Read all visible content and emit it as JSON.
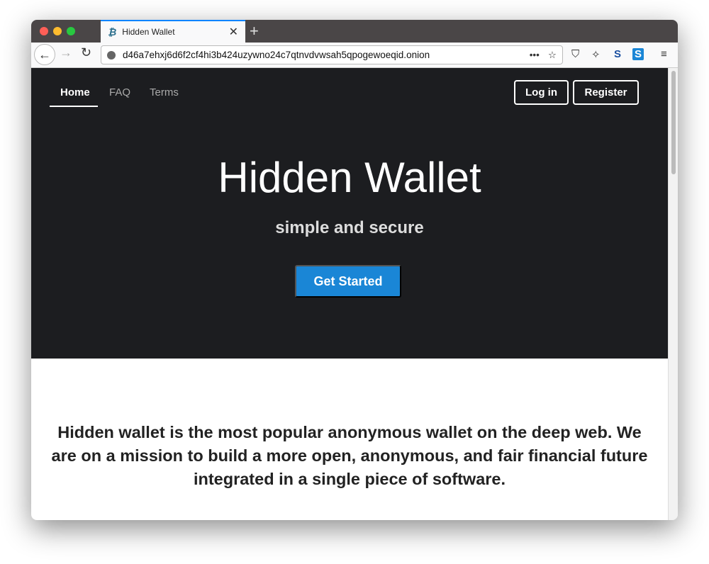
{
  "browser": {
    "tab_title": "Hidden Wallet",
    "tab_icon": "bitcoin-icon",
    "url": "d46a7ehxj6d6f2cf4hi3b424uzywno24c7qtnvdvwsah5qpogewoeqid.onion",
    "colors": {
      "close": "#fe5f57",
      "minimize": "#febc2e",
      "maximize": "#28c840",
      "tab_accent": "#0a84ff"
    }
  },
  "nav": {
    "items": [
      {
        "label": "Home",
        "active": true
      },
      {
        "label": "FAQ"
      },
      {
        "label": "Terms"
      }
    ],
    "login": "Log in",
    "register": "Register"
  },
  "hero": {
    "title": "Hidden Wallet",
    "subtitle": "simple and secure",
    "cta": "Get Started",
    "cta_color": "#1a86d6",
    "bg": "#1c1d20"
  },
  "mission": "Hidden wallet is the most popular anonymous wallet on the deep web. We are on a mission to build a more open, anonymous, and fair financial future integrated in a single piece of software."
}
